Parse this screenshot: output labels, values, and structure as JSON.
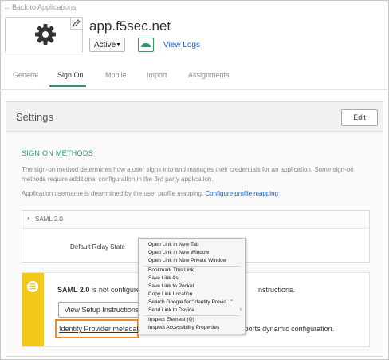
{
  "nav": {
    "back_label": "Back to Applications"
  },
  "app": {
    "title": "app.f5sec.net",
    "status_value": "Active",
    "view_logs_label": "View Logs"
  },
  "tabs": [
    {
      "label": "General"
    },
    {
      "label": "Sign On"
    },
    {
      "label": "Mobile"
    },
    {
      "label": "Import"
    },
    {
      "label": "Assignments"
    }
  ],
  "active_tab": "Sign On",
  "settings": {
    "title": "Settings",
    "edit_label": "Edit",
    "section_title": "SIGN ON METHODS",
    "description": "The sign-on method determines how a user signs into and manages their credentials for an application. Some sign-on methods require additional configuration in the 3rd party application.",
    "username_text": "Application username is determined by the user profile mapping.",
    "configure_link": "Configure profile mapping",
    "saml_label": "SAML 2.0",
    "relay_label": "Default Relay State",
    "warning_bold": "SAML 2.0",
    "warning_text": " is not configured",
    "warning_end": "nstructions.",
    "setup_button": "View Setup Instructions",
    "idp_link": "Identity Provider metadata",
    "idp_rest": " is available if this application supports dynamic configuration."
  },
  "context_menu": {
    "items": [
      "Open Link in New Tab",
      "Open Link in New Window",
      "Open Link in New Private Window",
      "Bookmark This Link",
      "Save Link As...",
      "Save Link to Pocket",
      "Copy Link Location",
      "Search Google for “Identity Provid...”",
      "Send Link to Device",
      "Inspect Element (Q)",
      "Inspect Accessibility Properties"
    ],
    "submenu_indicator": "›"
  },
  "colors": {
    "accent": "#2d9a6a",
    "link": "#1662dd",
    "warning": "#f2c81a",
    "highlight": "#f08a24"
  }
}
